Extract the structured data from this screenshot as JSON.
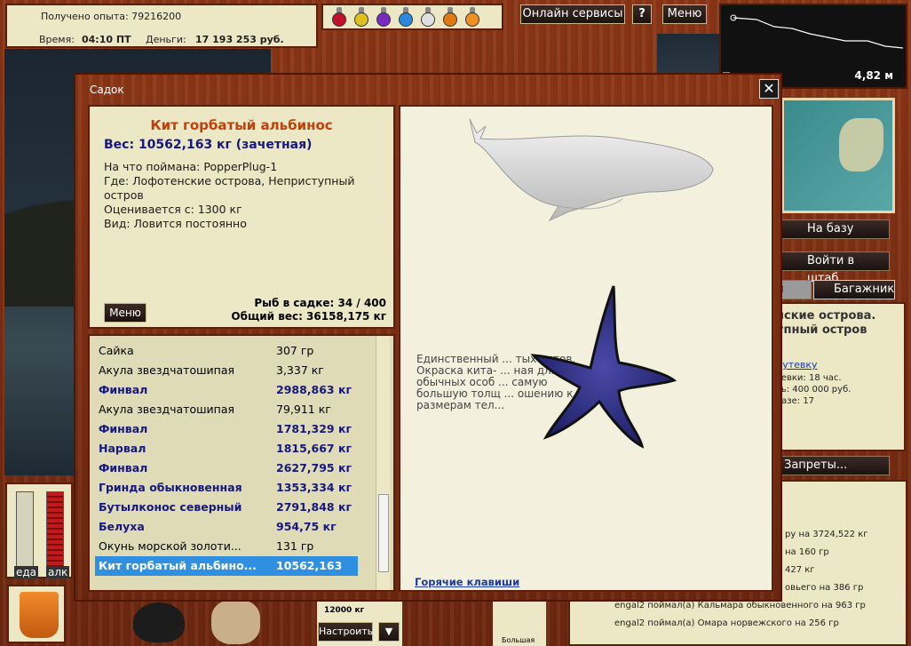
{
  "info": {
    "exp_text": "Получено опыта: 79216200",
    "time_label": "Время:",
    "time_value": "04:10 ПТ",
    "money_label": "Деньги:",
    "money_value": "17 193 253 руб."
  },
  "top_buttons": {
    "online": "Онлайн сервисы",
    "help": "?",
    "menu": "Меню"
  },
  "potions": [
    "#c0102a",
    "#e0c020",
    "#7a2ac0",
    "#2a8ae0",
    "#e0e0e0",
    "#e07a10",
    "#f09020"
  ],
  "minimap": {
    "distance": "4,82 м"
  },
  "side": {
    "base": "На базу",
    "hq": "Войти в штаб",
    "cut": "м",
    "trunk": "Багажник",
    "bans": "Запреты..."
  },
  "location": {
    "line1": "нские острова.",
    "line2": "упный остров",
    "link": "путевку",
    "d1": "тевки: 18 час.",
    "d2": "ть: 400 000 руб.",
    "d3": "базе: 17"
  },
  "chat": [
    "ру на 3724,522 кг",
    "на 160 гр",
    "427 кг",
    "овьего на 386 гр",
    "engal2 поймал(а) Кальмара обыкновенного на 963 гр",
    "engal2 поймал(а) Омара норвежского на 256 гр"
  ],
  "status": {
    "food": "еда",
    "alc": "алк",
    "food_level": 1.0,
    "alc_level": 1.0
  },
  "gear": {
    "capacity": "12000 кг",
    "setup": "Настроить",
    "dropdown": "▼",
    "bait": "Большая"
  },
  "dialog": {
    "title": "Садок",
    "close": "✕",
    "fish_name": "Кит горбатый альбинос",
    "fish_weight": "Вес: 10562,163 кг (зачетная)",
    "caught_on": "На что поймана: PopperPlug-1",
    "where": "Где: Лофотенские острова, Неприступный",
    "where2": "остров",
    "rated": "Оценивается с: 1300 кг",
    "kind": "Вид: Ловится постоянно",
    "menu": "Меню",
    "keep_count": "Рыб в садке: 34 / 400",
    "keep_weight": "Общий вес: 36158,175 кг",
    "fish_list": [
      {
        "name": "Сайка",
        "weight": "307 гр",
        "bold": false
      },
      {
        "name": "Акула звездчатошипая",
        "weight": "3,337 кг",
        "bold": false
      },
      {
        "name": "Финвал",
        "weight": "2988,863 кг",
        "bold": true
      },
      {
        "name": "Акула звездчатошипая",
        "weight": "79,911 кг",
        "bold": false
      },
      {
        "name": "Финвал",
        "weight": "1781,329 кг",
        "bold": true
      },
      {
        "name": "Нарвал",
        "weight": "1815,667 кг",
        "bold": true
      },
      {
        "name": "Финвал",
        "weight": "2627,795 кг",
        "bold": true
      },
      {
        "name": "Гринда обыкновенная",
        "weight": "1353,334 кг",
        "bold": true
      },
      {
        "name": "Бутылконос северный",
        "weight": "2791,848 кг",
        "bold": true
      },
      {
        "name": "Белуха",
        "weight": "954,75 кг",
        "bold": true
      },
      {
        "name": "Окунь морской золоти...",
        "weight": "131 гр",
        "bold": false
      },
      {
        "name": "Кит горбатый альбино...",
        "weight": "10562,163",
        "bold": true,
        "selected": true
      }
    ],
    "description": [
      "Единственный ... тых китов.",
      "Окраска кита- ... ная для",
      "обычных особ ... самую",
      "большую толщ ... ошению к",
      "размерам тел..."
    ],
    "hotkeys": "Горячие клавиши"
  }
}
